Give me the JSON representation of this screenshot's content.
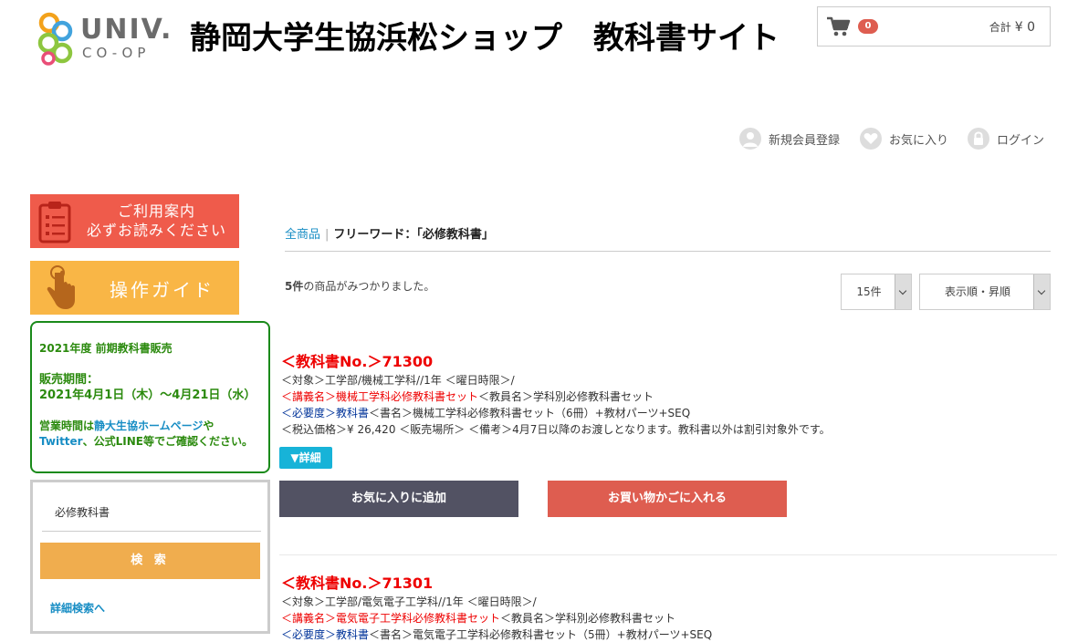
{
  "header": {
    "logo_univ": "UNIV.",
    "logo_coop": "CO-OP",
    "site_title": "静岡大学生協浜松ショップ　教科書サイト",
    "cart_count": "0",
    "cart_total_label": "合計",
    "cart_total_value": "¥ 0"
  },
  "user_nav": {
    "register": "新規会員登録",
    "favorites": "お気に入り",
    "login": "ログイン"
  },
  "sidebar": {
    "guide_line1": "ご利用案内",
    "guide_line2": "必ずお読みください",
    "operation_guide": "操作ガイド",
    "info": {
      "title": "2021年度 前期教科書販売",
      "period_label": "販売期間：",
      "period_value": "2021年4月1日（木）～4月21日（水）",
      "hours_pre": "営業時間は",
      "hours_link": "静大生協ホームページ",
      "hours_mid": "や",
      "twitter": "Twitter",
      "hours_post": "、公式LINE等でご確認ください。"
    },
    "search": {
      "value": "必修教科書",
      "button": "検 索",
      "advanced_link": "詳細検索へ"
    }
  },
  "main": {
    "breadcrumb_all": "全商品",
    "breadcrumb_current": "フリーワード：「必修教科書」",
    "result_count": "5件",
    "result_text": "の商品がみつかりました。",
    "per_page": "15件",
    "sort": "表示順・昇順",
    "detail_button": "▼詳細",
    "fav_button": "お気に入りに追加",
    "cart_button": "お買い物かごに入れる",
    "labels": {
      "target": "＜対象＞",
      "day": "＜曜日時限＞",
      "course": "＜講義名＞",
      "teacher": "＜教員名＞",
      "need": "＜必要度＞",
      "book": "＜書名＞",
      "price": "＜税込価格＞",
      "place": "＜販売場所＞",
      "note": "＜備考＞"
    },
    "products": [
      {
        "number": "＜教科書No.＞71300",
        "target": "工学部/機械工学科//1年",
        "day": "/",
        "course": "機械工学科必修教科書セット",
        "teacher": "学科別必修教科書セット",
        "need": "教科書",
        "book": "機械工学科必修教科書セット（6冊）+教材パーツ+SEQ",
        "price": "¥ 26,420",
        "place": "",
        "note": "4月7日以降のお渡しとなります。教科書以外は割引対象外です。"
      },
      {
        "number": "＜教科書No.＞71301",
        "target": "工学部/電気電子工学科//1年",
        "day": "/",
        "course": "電気電子工学科必修教科書セット",
        "teacher": "学科別必修教科書セット",
        "need": "教科書",
        "book": "電気電子工学科必修教科書セット（5冊）+教材パーツ+SEQ"
      }
    ]
  }
}
